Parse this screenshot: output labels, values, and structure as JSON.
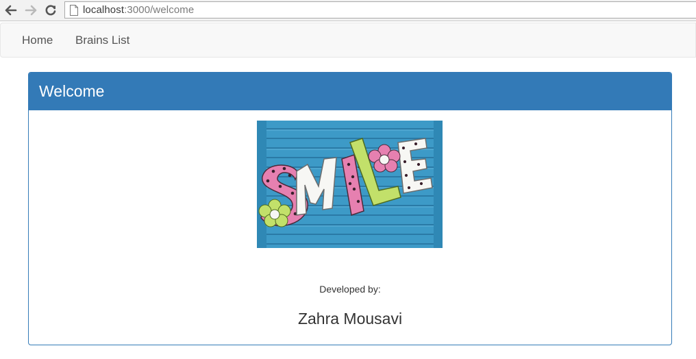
{
  "browser": {
    "url_host": "localhost",
    "url_path": ":3000/welcome",
    "back_icon": "arrow-left-icon",
    "forward_icon": "arrow-right-icon",
    "reload_icon": "reload-icon",
    "page_icon": "document-icon"
  },
  "navbar": {
    "links": [
      {
        "label": "Home"
      },
      {
        "label": "Brains List"
      }
    ]
  },
  "panel": {
    "title": "Welcome",
    "heading_color": "#337ab7",
    "image": {
      "word": "SMILE",
      "letter_colors": [
        "#e680b0",
        "#ffffff",
        "#e680b0",
        "#c2e06a",
        "#ffffff"
      ]
    },
    "developed_by_label": "Developed by:",
    "developer_name": "Zahra Mousavi"
  }
}
